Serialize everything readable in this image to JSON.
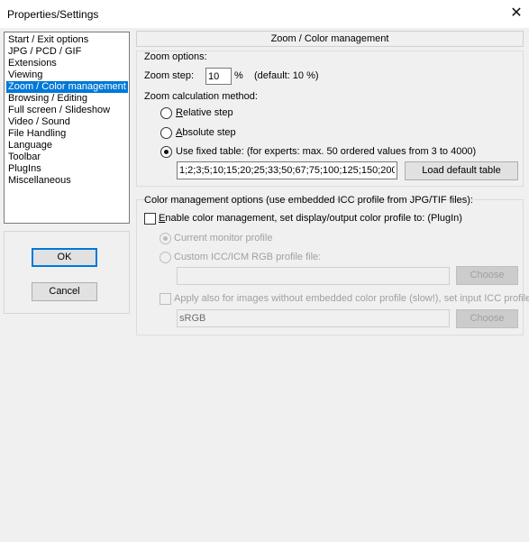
{
  "window": {
    "title": "Properties/Settings",
    "close_glyph": "✕"
  },
  "sidebar": {
    "items": [
      "Start / Exit options",
      "JPG / PCD / GIF",
      "Extensions",
      "Viewing",
      "Zoom / Color management",
      "Browsing / Editing",
      "Full screen / Slideshow",
      "Video / Sound",
      "File Handling",
      "Language",
      "Toolbar",
      "PlugIns",
      "Miscellaneous"
    ],
    "selected_index": 4
  },
  "buttons": {
    "ok": "OK",
    "cancel": "Cancel"
  },
  "header": {
    "title": "Zoom / Color management"
  },
  "zoom": {
    "group_label": "Zoom options:",
    "step_label": "Zoom step:",
    "step_value": "10",
    "step_unit": "%",
    "step_default": "(default: 10 %)",
    "method_label": "Zoom calculation method:",
    "relative_first": "R",
    "relative_rest": "elative step",
    "absolute_first": "A",
    "absolute_rest": "bsolute step",
    "fixed_label": "Use fixed table: (for experts: max. 50 ordered values from 3 to 4000)",
    "fixed_value": "1;2;3;5;10;15;20;25;33;50;67;75;100;125;150;200;",
    "load_default": "Load default table",
    "selected_method": "fixed"
  },
  "color": {
    "group_label": "Color management options (use embedded ICC profile from JPG/TIF files):",
    "enable_first": "E",
    "enable_rest": "nable color management, set display/output color profile to: (PlugIn)",
    "current_monitor": "Current monitor profile",
    "custom_icc": "Custom ICC/ICM RGB profile file:",
    "custom_path": "",
    "choose": "Choose",
    "apply_also": "Apply also for images without embedded color profile (slow!), set input ICC profile:",
    "input_profile": "sRGB",
    "choose2": "Choose"
  }
}
